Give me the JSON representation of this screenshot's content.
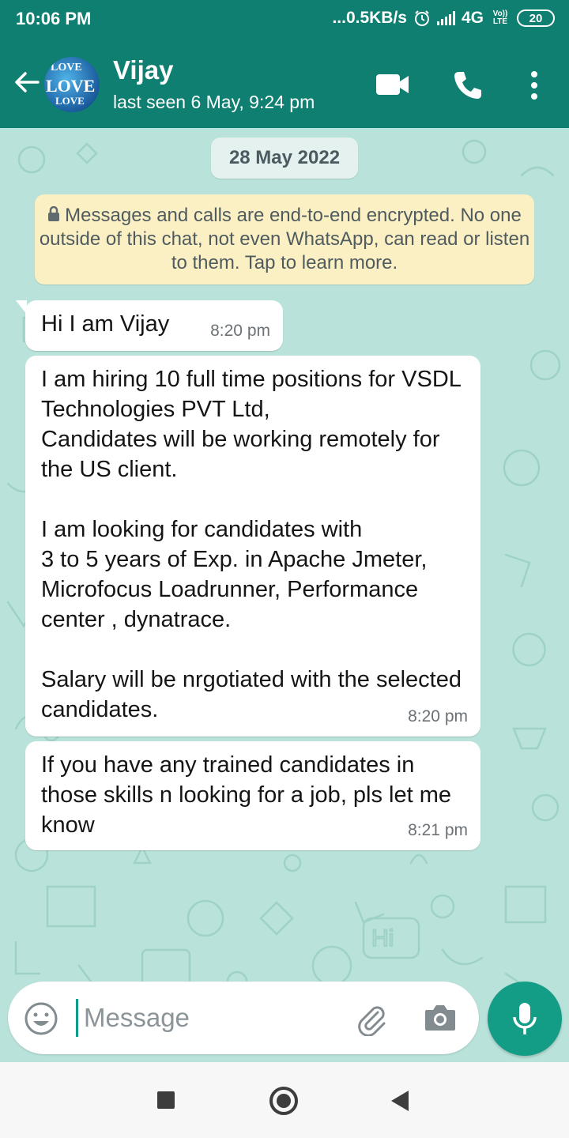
{
  "status_bar": {
    "time": "10:06 PM",
    "network_speed": "...0.5KB/s",
    "network_type": "4G",
    "volte_label": "Vo)) LTE",
    "battery": "20"
  },
  "header": {
    "contact_name": "Vijay",
    "last_seen": "last seen 6 May, 9:24 pm",
    "avatar_text": "LOVE"
  },
  "chat": {
    "date_chip": "28 May 2022",
    "encryption_notice": "Messages and calls are end-to-end encrypted. No one outside of this chat, not even WhatsApp, can read or listen to them. Tap to learn more.",
    "messages": [
      {
        "text": "Hi I am Vijay",
        "time": "8:20 pm"
      },
      {
        "text": "I am hiring 10 full time positions  for VSDL Technologies PVT Ltd,\nCandidates will be working remotely for the US client.\n\n I am looking for candidates with\n3 to 5 years of Exp. in Apache Jmeter, Microfocus Loadrunner, Performance center , dynatrace.\n\n Salary will be nrgotiated with the selected candidates.",
        "time": "8:20 pm"
      },
      {
        "text": "If you have any trained candidates in those skills n looking for a job, pls let me know",
        "time": "8:21 pm"
      }
    ]
  },
  "composer": {
    "placeholder": "Message"
  },
  "colors": {
    "header": "#0f7f72",
    "chat_background": "#b9e3da",
    "bubble": "#ffffff",
    "encryption_notice": "#fbf0c4",
    "mic_button": "#139c86"
  },
  "icons": [
    "back-arrow-icon",
    "video-call-icon",
    "voice-call-icon",
    "more-options-icon",
    "lock-icon",
    "emoji-icon",
    "attach-icon",
    "camera-icon",
    "mic-icon",
    "nav-recents-icon",
    "nav-home-icon",
    "nav-back-icon"
  ]
}
